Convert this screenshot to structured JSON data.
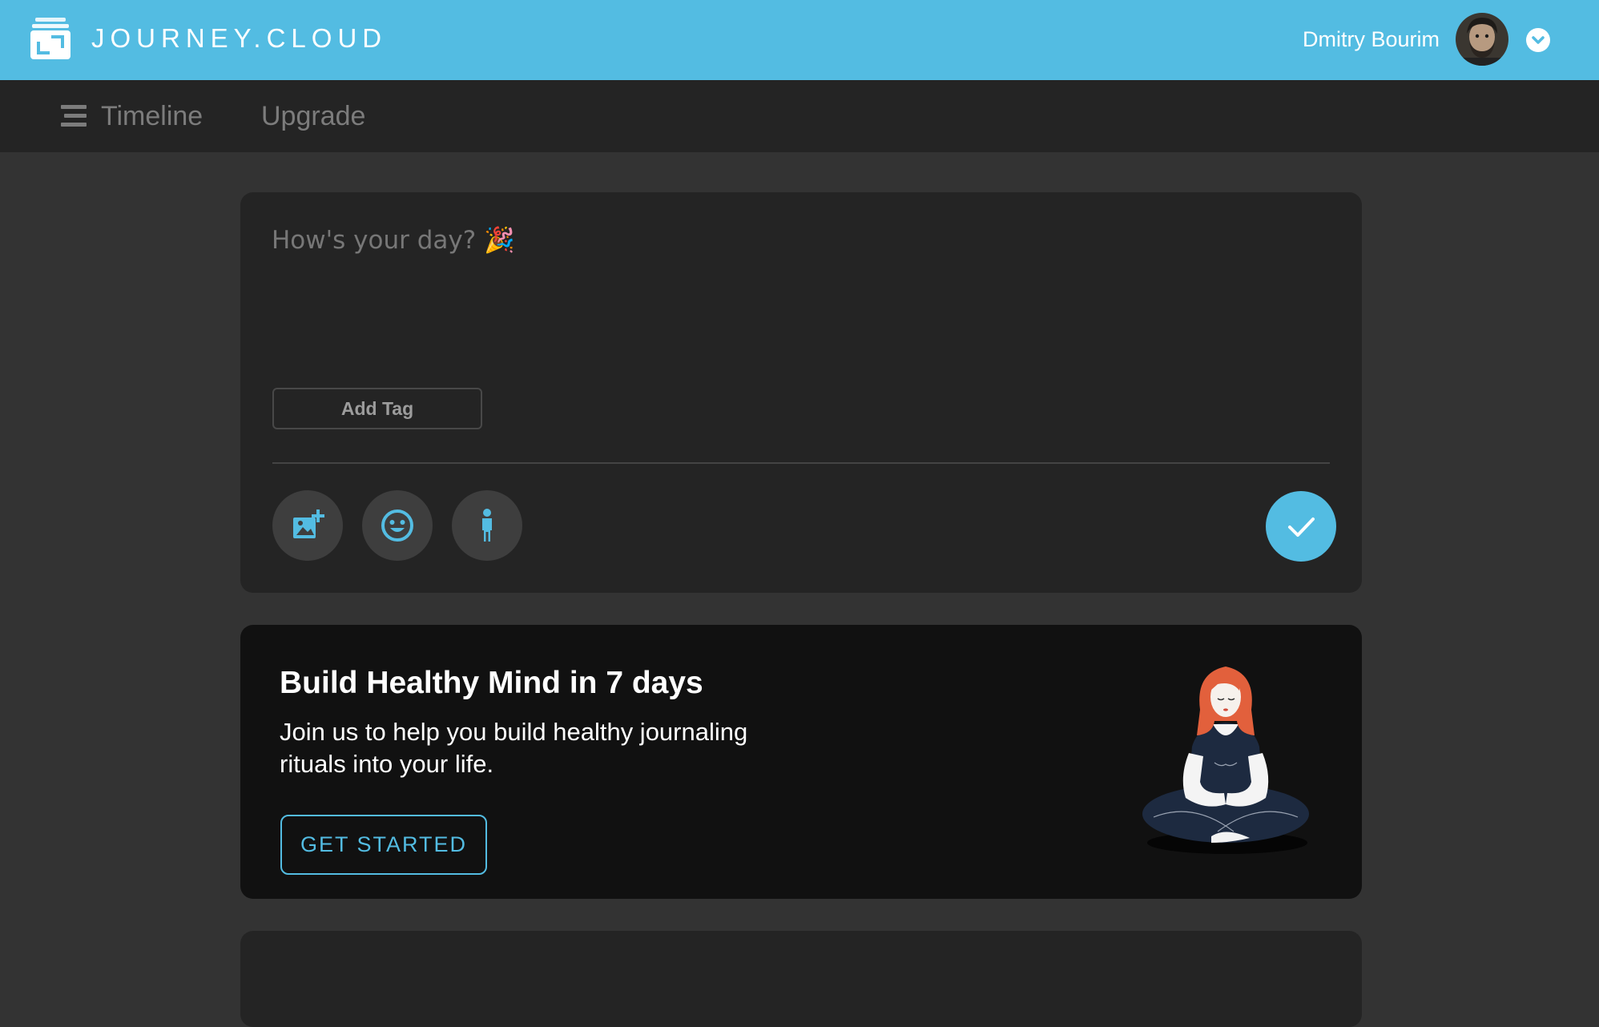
{
  "header": {
    "brand": "JOURNEY.CLOUD",
    "user_name": "Dmitry Bourim",
    "bg_color": "#53bce2",
    "icons": [
      "journal-icon",
      "avatar",
      "chevron-down-icon"
    ]
  },
  "nav": {
    "items": [
      {
        "label": "Timeline",
        "icon": "menu-icon"
      },
      {
        "label": "Upgrade"
      }
    ]
  },
  "composer": {
    "placeholder": "How's your day? 🎉",
    "add_tag_label": "Add Tag",
    "tools": [
      "add-photo-icon",
      "mood-icon",
      "activity-icon"
    ],
    "submit_icon": "checkmark-icon",
    "accent_color": "#53bce2"
  },
  "promo": {
    "title": "Build Healthy Mind in 7 days",
    "body": "Join us to help you build healthy journaling rituals into your life.",
    "cta_label": "GET STARTED",
    "illustration": "meditating-woman-illustration"
  }
}
